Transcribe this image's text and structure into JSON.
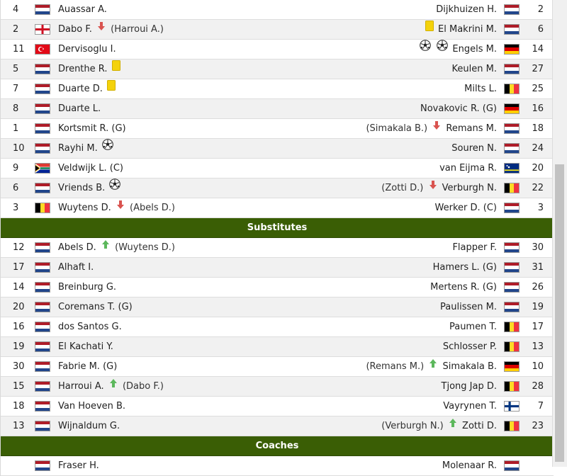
{
  "headers": {
    "substitutes": "Substitutes",
    "coaches": "Coaches"
  },
  "starters": [
    {
      "num": "4",
      "lflag": "nl",
      "left": [
        {
          "t": "Auassar A."
        }
      ],
      "right": [
        {
          "t": "Dijkhuizen H."
        }
      ],
      "rflag": "nl",
      "rnum": "2"
    },
    {
      "num": "2",
      "lflag": "en",
      "left": [
        {
          "t": "Dabo F."
        },
        {
          "i": "arrow-down"
        },
        {
          "t": "(Harroui A.)"
        }
      ],
      "right": [
        {
          "i": "yellow-card"
        },
        {
          "t": "El Makrini M."
        }
      ],
      "rflag": "nl",
      "rnum": "6"
    },
    {
      "num": "11",
      "lflag": "tr",
      "left": [
        {
          "t": "Dervisoglu I."
        }
      ],
      "right": [
        {
          "i": "ball"
        },
        {
          "i": "ball"
        },
        {
          "t": "Engels M."
        }
      ],
      "rflag": "de",
      "rnum": "14"
    },
    {
      "num": "5",
      "lflag": "nl",
      "left": [
        {
          "t": "Drenthe R."
        },
        {
          "i": "yellow-card"
        }
      ],
      "right": [
        {
          "t": "Keulen M."
        }
      ],
      "rflag": "nl",
      "rnum": "27"
    },
    {
      "num": "7",
      "lflag": "nl",
      "left": [
        {
          "t": "Duarte D."
        },
        {
          "i": "yellow-card"
        }
      ],
      "right": [
        {
          "t": "Milts L."
        }
      ],
      "rflag": "be",
      "rnum": "25"
    },
    {
      "num": "8",
      "lflag": "nl",
      "left": [
        {
          "t": "Duarte L."
        }
      ],
      "right": [
        {
          "t": "Novakovic R. (G)"
        }
      ],
      "rflag": "de",
      "rnum": "16"
    },
    {
      "num": "1",
      "lflag": "nl",
      "left": [
        {
          "t": "Kortsmit R. (G)"
        }
      ],
      "right": [
        {
          "t": "(Simakala B.)"
        },
        {
          "i": "arrow-down"
        },
        {
          "t": "Remans M."
        }
      ],
      "rflag": "nl",
      "rnum": "18"
    },
    {
      "num": "10",
      "lflag": "nl",
      "left": [
        {
          "t": "Rayhi M."
        },
        {
          "i": "ball"
        }
      ],
      "right": [
        {
          "t": "Souren N."
        }
      ],
      "rflag": "nl",
      "rnum": "24"
    },
    {
      "num": "9",
      "lflag": "za",
      "left": [
        {
          "t": "Veldwijk L. (C)"
        }
      ],
      "right": [
        {
          "t": "van Eijma R."
        }
      ],
      "rflag": "cw",
      "rnum": "20"
    },
    {
      "num": "6",
      "lflag": "nl",
      "left": [
        {
          "t": "Vriends B."
        },
        {
          "i": "ball"
        }
      ],
      "right": [
        {
          "t": "(Zotti D.)"
        },
        {
          "i": "arrow-down"
        },
        {
          "t": "Verburgh N."
        }
      ],
      "rflag": "be",
      "rnum": "22"
    },
    {
      "num": "3",
      "lflag": "be",
      "left": [
        {
          "t": "Wuytens D."
        },
        {
          "i": "arrow-down"
        },
        {
          "t": "(Abels D.)"
        }
      ],
      "right": [
        {
          "t": "Werker D. (C)"
        }
      ],
      "rflag": "nl",
      "rnum": "3"
    }
  ],
  "substitutes": [
    {
      "num": "12",
      "lflag": "nl",
      "left": [
        {
          "t": "Abels D."
        },
        {
          "i": "arrow-up"
        },
        {
          "t": "(Wuytens D.)"
        }
      ],
      "right": [
        {
          "t": "Flapper F."
        }
      ],
      "rflag": "nl",
      "rnum": "30"
    },
    {
      "num": "17",
      "lflag": "nl",
      "left": [
        {
          "t": "Alhaft I."
        }
      ],
      "right": [
        {
          "t": "Hamers L. (G)"
        }
      ],
      "rflag": "nl",
      "rnum": "31"
    },
    {
      "num": "14",
      "lflag": "nl",
      "left": [
        {
          "t": "Breinburg G."
        }
      ],
      "right": [
        {
          "t": "Mertens R. (G)"
        }
      ],
      "rflag": "nl",
      "rnum": "26"
    },
    {
      "num": "20",
      "lflag": "nl",
      "left": [
        {
          "t": "Coremans T. (G)"
        }
      ],
      "right": [
        {
          "t": "Paulissen M."
        }
      ],
      "rflag": "nl",
      "rnum": "19"
    },
    {
      "num": "16",
      "lflag": "nl",
      "left": [
        {
          "t": "dos Santos G."
        }
      ],
      "right": [
        {
          "t": "Paumen T."
        }
      ],
      "rflag": "be",
      "rnum": "17"
    },
    {
      "num": "19",
      "lflag": "nl",
      "left": [
        {
          "t": "El Kachati Y."
        }
      ],
      "right": [
        {
          "t": "Schlosser P."
        }
      ],
      "rflag": "be",
      "rnum": "13"
    },
    {
      "num": "30",
      "lflag": "nl",
      "left": [
        {
          "t": "Fabrie M. (G)"
        }
      ],
      "right": [
        {
          "t": "(Remans M.)"
        },
        {
          "i": "arrow-up"
        },
        {
          "t": "Simakala B."
        }
      ],
      "rflag": "de",
      "rnum": "10"
    },
    {
      "num": "15",
      "lflag": "nl",
      "left": [
        {
          "t": "Harroui A."
        },
        {
          "i": "arrow-up"
        },
        {
          "t": "(Dabo F.)"
        }
      ],
      "right": [
        {
          "t": "Tjong Jap D."
        }
      ],
      "rflag": "be",
      "rnum": "28"
    },
    {
      "num": "18",
      "lflag": "nl",
      "left": [
        {
          "t": "Van Hoeven B."
        }
      ],
      "right": [
        {
          "t": "Vayrynen T."
        }
      ],
      "rflag": "fi",
      "rnum": "7"
    },
    {
      "num": "13",
      "lflag": "nl",
      "left": [
        {
          "t": "Wijnaldum G."
        }
      ],
      "right": [
        {
          "t": "(Verburgh N.)"
        },
        {
          "i": "arrow-up"
        },
        {
          "t": "Zotti D."
        }
      ],
      "rflag": "be",
      "rnum": "23"
    }
  ],
  "coaches": [
    {
      "num": "",
      "lflag": "nl",
      "left": [
        {
          "t": "Fraser H."
        }
      ],
      "right": [
        {
          "t": "Molenaar R."
        }
      ],
      "rflag": "nl",
      "rnum": ""
    }
  ],
  "colors": {
    "header_bg": "#3a5e05",
    "row_alt": "#f1f1f1",
    "yellow_card": "#f4d20b",
    "arrow_down": "#d9534f",
    "arrow_up": "#5cb85c"
  }
}
